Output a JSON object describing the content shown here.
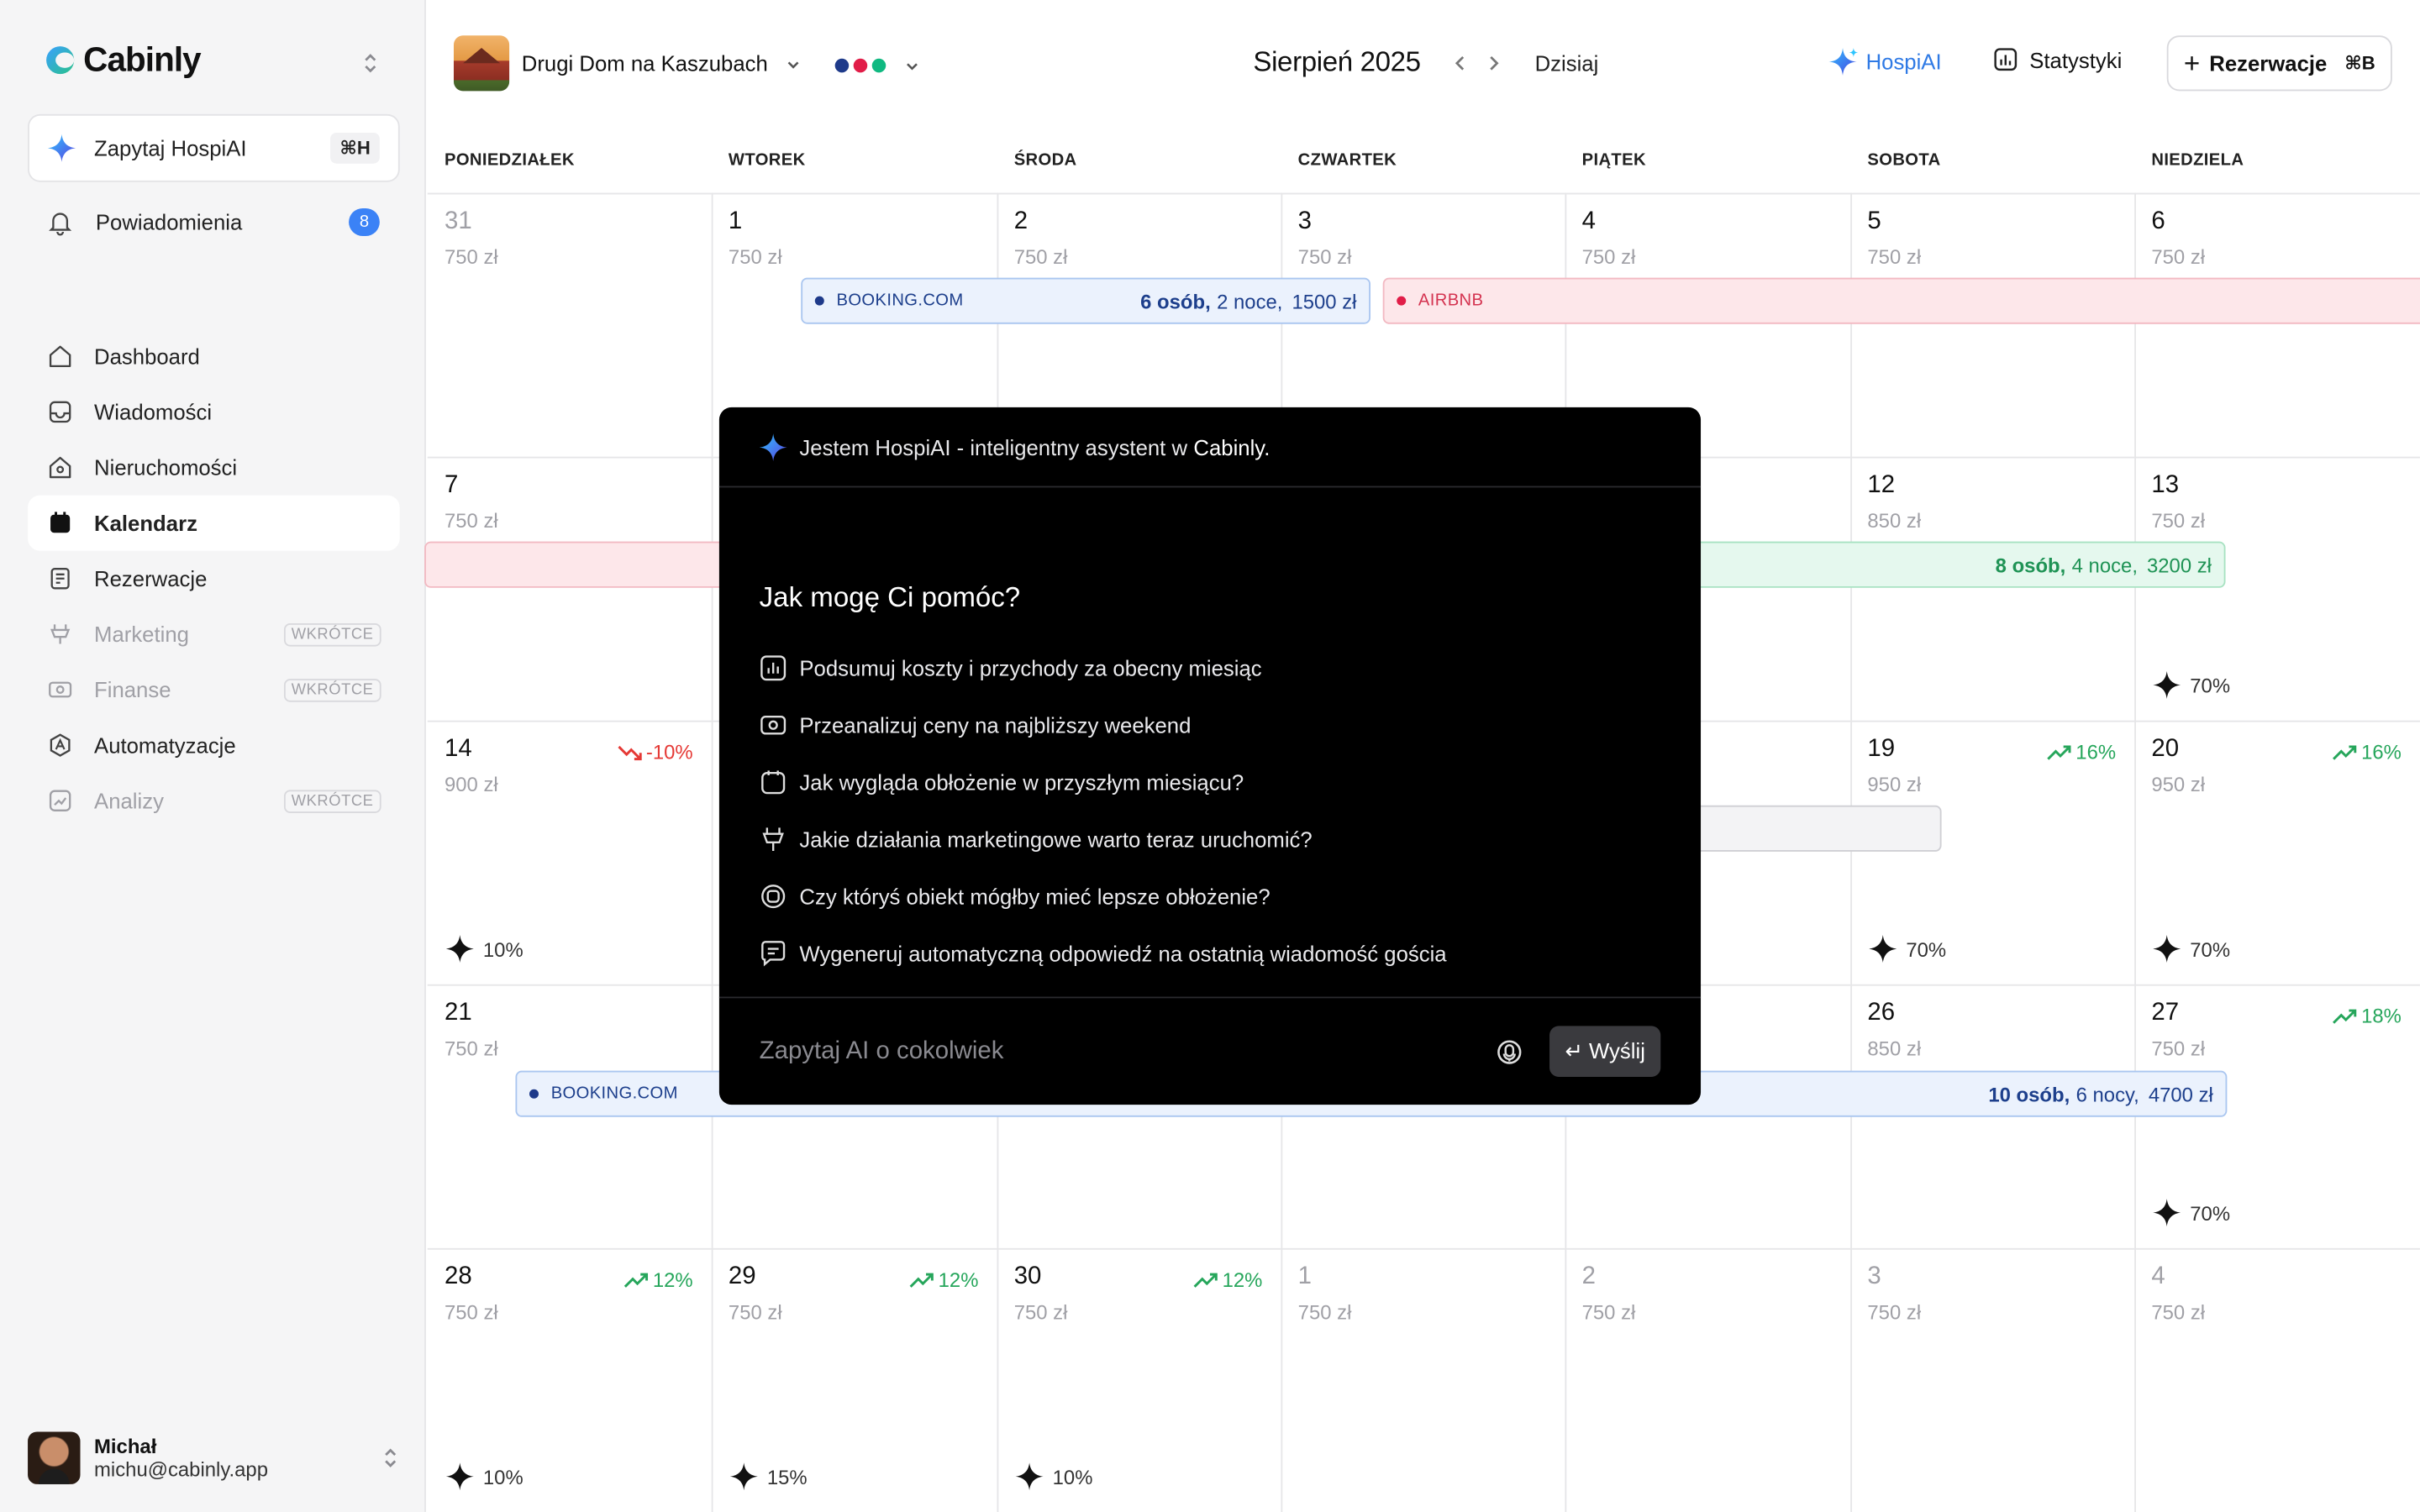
{
  "sidebar": {
    "brand": "Cabinly",
    "ask": {
      "label": "Zapytaj HospiAI",
      "shortcut": "⌘H"
    },
    "notifications": {
      "label": "Powiadomienia",
      "count": "8"
    },
    "nav": [
      {
        "label": "Dashboard",
        "icon": "home-icon"
      },
      {
        "label": "Wiadomości",
        "icon": "inbox-icon"
      },
      {
        "label": "Nieruchomości",
        "icon": "house-icon"
      },
      {
        "label": "Kalendarz",
        "icon": "calendar-icon",
        "active": true
      },
      {
        "label": "Rezerwacje",
        "icon": "receipt-icon"
      },
      {
        "label": "Marketing",
        "icon": "marketing-icon",
        "soon": "WKRÓTCE"
      },
      {
        "label": "Finanse",
        "icon": "money-icon",
        "soon": "WKRÓTCE"
      },
      {
        "label": "Automatyzacje",
        "icon": "automation-icon"
      },
      {
        "label": "Analizy",
        "icon": "chart-icon",
        "soon": "WKRÓTCE"
      }
    ],
    "user": {
      "name": "Michał",
      "email": "michu@cabinly.app"
    }
  },
  "header": {
    "property": "Drugi Dom na Kaszubach",
    "dot_colors": [
      "#1e3a8a",
      "#e11d48",
      "#10b981"
    ],
    "month": "Sierpień 2025",
    "today": "Dzisiaj",
    "hospiai": "HospiAI",
    "stats": "Statystyki",
    "reservations": "Rezerwacje",
    "reservations_shortcut": "⌘B"
  },
  "calendar": {
    "weekdays": [
      "PONIEDZIAŁEK",
      "WTOREK",
      "ŚRODA",
      "CZWARTEK",
      "PIĄTEK",
      "SOBOTA",
      "NIEDZIELA"
    ],
    "days": [
      {
        "d": "31",
        "p": "750 zł",
        "muted": true
      },
      {
        "d": "1",
        "p": "750 zł"
      },
      {
        "d": "2",
        "p": "750 zł"
      },
      {
        "d": "3",
        "p": "750 zł"
      },
      {
        "d": "4",
        "p": "750 zł"
      },
      {
        "d": "5",
        "p": "750 zł"
      },
      {
        "d": "6",
        "p": "750 zł"
      },
      {
        "d": "7",
        "p": "750 zł"
      },
      {
        "d": "",
        "p": ""
      },
      {
        "d": "",
        "p": ""
      },
      {
        "d": "",
        "p": ""
      },
      {
        "d": "",
        "p": ""
      },
      {
        "d": "12",
        "p": "850 zł"
      },
      {
        "d": "13",
        "p": "750 zł",
        "occ": "70%"
      },
      {
        "d": "14",
        "p": "900 zł",
        "trend": "-10%",
        "dir": "down",
        "occ": "10%"
      },
      {
        "d": "",
        "p": ""
      },
      {
        "d": "",
        "p": ""
      },
      {
        "d": "",
        "p": ""
      },
      {
        "d": "",
        "p": ""
      },
      {
        "d": "19",
        "p": "950 zł",
        "trend": "16%",
        "dir": "up",
        "occ": "70%"
      },
      {
        "d": "20",
        "p": "950 zł",
        "trend": "16%",
        "dir": "up",
        "occ": "70%"
      },
      {
        "d": "21",
        "p": "750 zł"
      },
      {
        "d": "",
        "p": ""
      },
      {
        "d": "",
        "p": ""
      },
      {
        "d": "",
        "p": ""
      },
      {
        "d": "",
        "p": ""
      },
      {
        "d": "26",
        "p": "850 zł"
      },
      {
        "d": "27",
        "p": "750 zł",
        "trend": "18%",
        "dir": "up",
        "occ": "70%"
      },
      {
        "d": "28",
        "p": "750 zł",
        "trend": "12%",
        "dir": "up",
        "occ": "10%"
      },
      {
        "d": "29",
        "p": "750 zł",
        "trend": "12%",
        "dir": "up",
        "occ": "15%"
      },
      {
        "d": "30",
        "p": "750 zł",
        "trend": "12%",
        "dir": "up",
        "occ": "10%"
      },
      {
        "d": "1",
        "p": "750 zł",
        "muted": true
      },
      {
        "d": "2",
        "p": "750 zł",
        "muted": true
      },
      {
        "d": "3",
        "p": "750 zł",
        "muted": true
      },
      {
        "d": "4",
        "p": "750 zł",
        "muted": true
      }
    ],
    "bookings": [
      {
        "source": "BOOKING.COM",
        "guests": "6 osób,",
        "nights": "2 noce,",
        "amount": "1500 zł"
      },
      {
        "source": "AIRBNB"
      },
      {
        "guests": "8 osób,",
        "nights": "4 noce,",
        "amount": "3200 zł"
      },
      {
        "source": "BOOKING.COM",
        "guests": "10 osób,",
        "nights": "6 nocy,",
        "amount": "4700 zł"
      }
    ]
  },
  "assistant": {
    "intro_prefix": "Jestem HospiAI - inteligentny asystent w ",
    "intro_brand": "Cabinly.",
    "question": "Jak mogę Ci pomóc?",
    "suggestions": [
      {
        "text": "Podsumuj koszty i przychody za obecny miesiąc",
        "icon": "chart-bars-icon"
      },
      {
        "text": "Przeanalizuj ceny na najbliższy weekend",
        "icon": "money-icon"
      },
      {
        "text": "Jak wygląda obłożenie w przyszłym miesiącu?",
        "icon": "calendar-icon"
      },
      {
        "text": "Jakie działania marketingowe warto teraz uruchomić?",
        "icon": "marketing-icon"
      },
      {
        "text": "Czy któryś obiekt mógłby mieć lepsze obłożenie?",
        "icon": "ai-icon"
      },
      {
        "text": "Wygeneruj automatyczną odpowiedź na ostatnią wiadomość gościa",
        "icon": "message-icon"
      }
    ],
    "placeholder": "Zapytaj AI o cokolwiek",
    "send": "↵ Wyślij"
  }
}
